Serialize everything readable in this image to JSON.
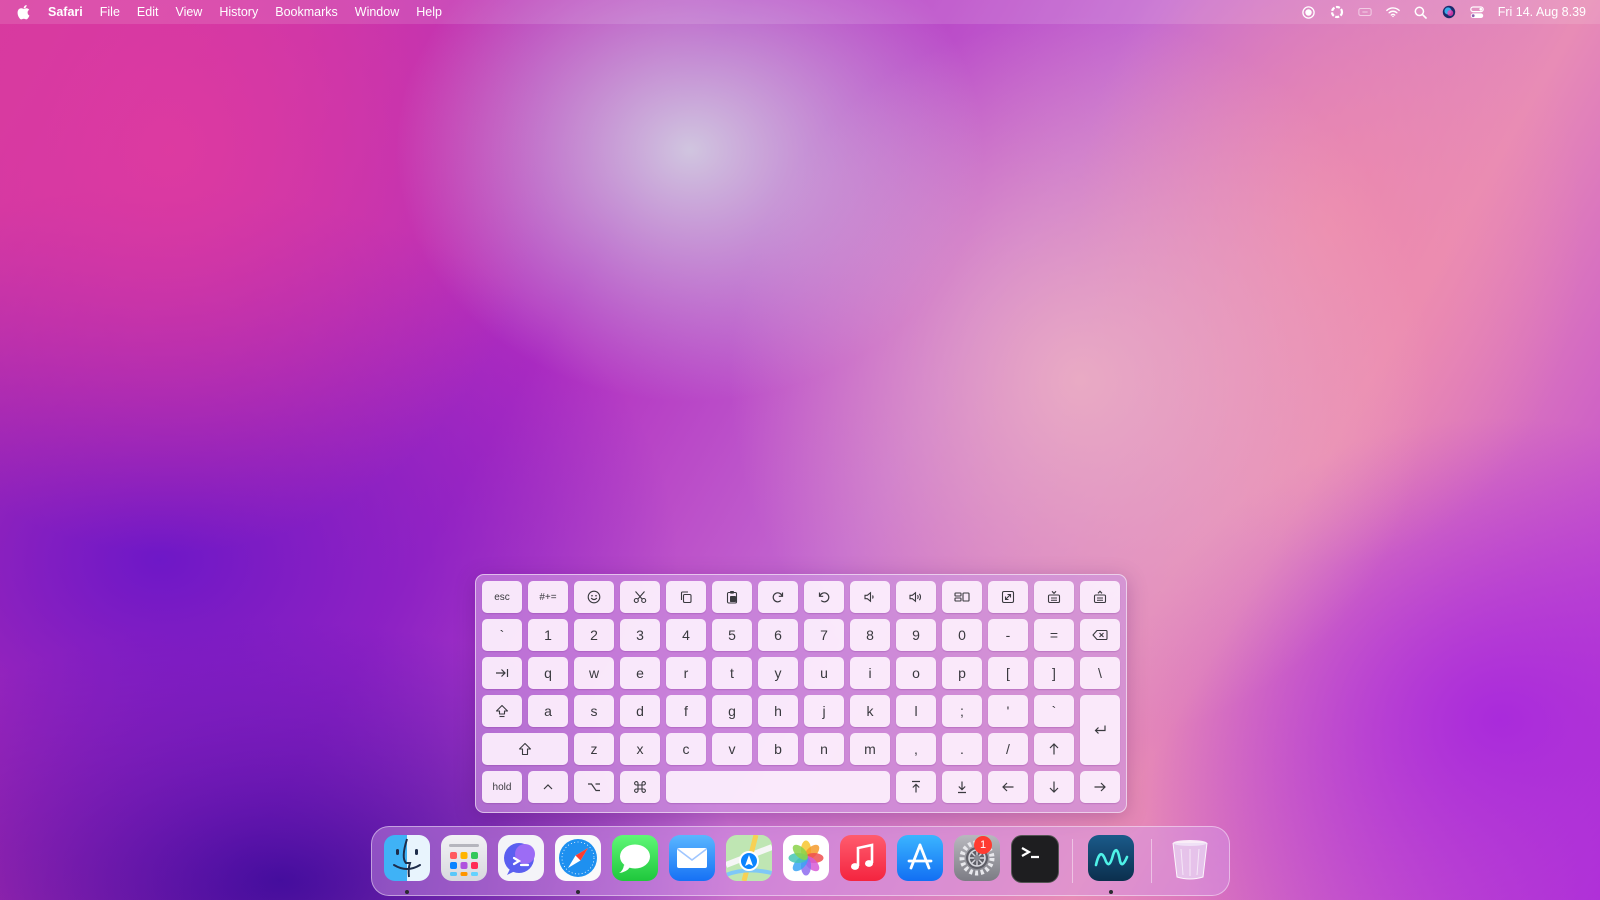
{
  "menubar": {
    "app_name": "Safari",
    "menus": [
      "File",
      "Edit",
      "View",
      "History",
      "Bookmarks",
      "Window",
      "Help"
    ],
    "status_icons": [
      "screen-record-icon",
      "focus-icon",
      "display-icon",
      "wifi-icon",
      "spotlight-icon",
      "siri-icon",
      "control-center-icon"
    ],
    "clock": "Fri 14. Aug  8.39"
  },
  "keyboard": {
    "rows": [
      [
        {
          "label": "esc",
          "name": "esc"
        },
        {
          "label": "#+=",
          "name": "symbols"
        },
        {
          "icon": "emoji-icon",
          "name": "emoji"
        },
        {
          "icon": "scissors-icon",
          "name": "cut"
        },
        {
          "icon": "copy-icon",
          "name": "copy"
        },
        {
          "icon": "paste-icon",
          "name": "paste"
        },
        {
          "icon": "redo-icon",
          "name": "redo"
        },
        {
          "icon": "undo-icon",
          "name": "undo"
        },
        {
          "icon": "volume-down-icon",
          "name": "volume-down"
        },
        {
          "icon": "volume-up-icon",
          "name": "volume-up"
        },
        {
          "icon": "window-arrange-icon",
          "name": "window-arrange"
        },
        {
          "icon": "resize-icon",
          "name": "resize"
        },
        {
          "icon": "keyboard-lower-icon",
          "name": "keyboard-lower"
        },
        {
          "icon": "keyboard-raise-icon",
          "name": "keyboard-raise"
        }
      ],
      [
        {
          "label": "`",
          "name": "backtick"
        },
        {
          "label": "1",
          "name": "1"
        },
        {
          "label": "2",
          "name": "2"
        },
        {
          "label": "3",
          "name": "3"
        },
        {
          "label": "4",
          "name": "4"
        },
        {
          "label": "5",
          "name": "5"
        },
        {
          "label": "6",
          "name": "6"
        },
        {
          "label": "7",
          "name": "7"
        },
        {
          "label": "8",
          "name": "8"
        },
        {
          "label": "9",
          "name": "9"
        },
        {
          "label": "0",
          "name": "0"
        },
        {
          "label": "-",
          "name": "minus"
        },
        {
          "label": "=",
          "name": "equals"
        },
        {
          "icon": "delete-icon",
          "name": "delete"
        }
      ],
      [
        {
          "icon": "tab-icon",
          "name": "tab"
        },
        {
          "label": "q",
          "name": "q"
        },
        {
          "label": "w",
          "name": "w"
        },
        {
          "label": "e",
          "name": "e"
        },
        {
          "label": "r",
          "name": "r"
        },
        {
          "label": "t",
          "name": "t"
        },
        {
          "label": "y",
          "name": "y"
        },
        {
          "label": "u",
          "name": "u"
        },
        {
          "label": "i",
          "name": "i"
        },
        {
          "label": "o",
          "name": "o"
        },
        {
          "label": "p",
          "name": "p"
        },
        {
          "label": "[",
          "name": "left-bracket"
        },
        {
          "label": "]",
          "name": "right-bracket"
        },
        {
          "label": "\\",
          "name": "backslash"
        }
      ],
      [
        {
          "icon": "caps-lock-icon",
          "name": "caps-lock"
        },
        {
          "label": "a",
          "name": "a"
        },
        {
          "label": "s",
          "name": "s"
        },
        {
          "label": "d",
          "name": "d"
        },
        {
          "label": "f",
          "name": "f"
        },
        {
          "label": "g",
          "name": "g"
        },
        {
          "label": "h",
          "name": "h"
        },
        {
          "label": "j",
          "name": "j"
        },
        {
          "label": "k",
          "name": "k"
        },
        {
          "label": "l",
          "name": "l"
        },
        {
          "label": ";",
          "name": "semicolon"
        },
        {
          "label": "'",
          "name": "quote"
        },
        {
          "label": "`",
          "name": "backtick-2"
        },
        {
          "icon": "return-icon",
          "name": "return"
        }
      ],
      [
        {
          "icon": "shift-icon",
          "name": "shift"
        },
        {
          "label": "z",
          "name": "z"
        },
        {
          "label": "x",
          "name": "x"
        },
        {
          "label": "c",
          "name": "c"
        },
        {
          "label": "v",
          "name": "v"
        },
        {
          "label": "b",
          "name": "b"
        },
        {
          "label": "n",
          "name": "n"
        },
        {
          "label": "m",
          "name": "m"
        },
        {
          "label": ",",
          "name": "comma"
        },
        {
          "label": ".",
          "name": "period"
        },
        {
          "label": "/",
          "name": "slash"
        },
        {
          "icon": "arrow-up-icon",
          "name": "up"
        }
      ],
      [
        {
          "label": "hold",
          "name": "hold"
        },
        {
          "icon": "control-icon",
          "name": "control"
        },
        {
          "icon": "option-icon",
          "name": "option"
        },
        {
          "icon": "command-icon",
          "name": "command"
        },
        {
          "label": "",
          "name": "space"
        },
        {
          "icon": "page-up-icon",
          "name": "page-up"
        },
        {
          "icon": "page-down-icon",
          "name": "page-down"
        },
        {
          "icon": "arrow-left-icon",
          "name": "left"
        },
        {
          "icon": "arrow-down-icon",
          "name": "down"
        },
        {
          "icon": "arrow-right-icon",
          "name": "right"
        }
      ]
    ]
  },
  "dock": {
    "apps": [
      {
        "name": "finder",
        "running": true
      },
      {
        "name": "launchpad",
        "running": false
      },
      {
        "name": "copilot",
        "running": false
      },
      {
        "name": "safari",
        "running": true
      },
      {
        "name": "messages",
        "running": false
      },
      {
        "name": "mail",
        "running": false
      },
      {
        "name": "maps",
        "running": false
      },
      {
        "name": "photos",
        "running": false
      },
      {
        "name": "music",
        "running": false
      },
      {
        "name": "app-store",
        "running": false
      },
      {
        "name": "system-settings",
        "running": false,
        "badge": "1"
      },
      {
        "name": "terminal",
        "running": false
      },
      {
        "name": "freeform",
        "running": true
      },
      {
        "name": "trash",
        "running": false
      }
    ]
  },
  "colors": {
    "key_fill": "#fdf0fd",
    "key_text": "#3a3a3f",
    "badge": "#ff3b30"
  }
}
